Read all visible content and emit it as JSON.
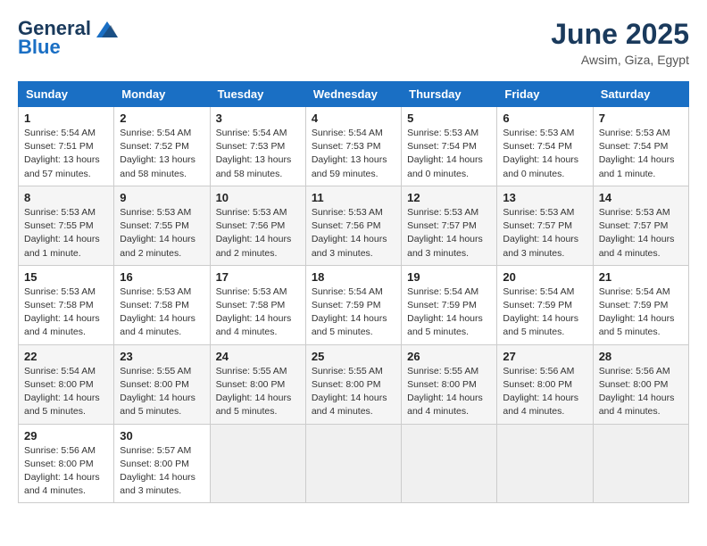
{
  "header": {
    "logo_general": "General",
    "logo_blue": "Blue",
    "month_title": "June 2025",
    "location": "Awsim, Giza, Egypt"
  },
  "weekdays": [
    "Sunday",
    "Monday",
    "Tuesday",
    "Wednesday",
    "Thursday",
    "Friday",
    "Saturday"
  ],
  "weeks": [
    [
      {
        "day": 1,
        "sunrise": "5:54 AM",
        "sunset": "7:51 PM",
        "daylight": "13 hours and 57 minutes."
      },
      {
        "day": 2,
        "sunrise": "5:54 AM",
        "sunset": "7:52 PM",
        "daylight": "13 hours and 58 minutes."
      },
      {
        "day": 3,
        "sunrise": "5:54 AM",
        "sunset": "7:53 PM",
        "daylight": "13 hours and 58 minutes."
      },
      {
        "day": 4,
        "sunrise": "5:54 AM",
        "sunset": "7:53 PM",
        "daylight": "13 hours and 59 minutes."
      },
      {
        "day": 5,
        "sunrise": "5:53 AM",
        "sunset": "7:54 PM",
        "daylight": "14 hours and 0 minutes."
      },
      {
        "day": 6,
        "sunrise": "5:53 AM",
        "sunset": "7:54 PM",
        "daylight": "14 hours and 0 minutes."
      },
      {
        "day": 7,
        "sunrise": "5:53 AM",
        "sunset": "7:54 PM",
        "daylight": "14 hours and 1 minute."
      }
    ],
    [
      {
        "day": 8,
        "sunrise": "5:53 AM",
        "sunset": "7:55 PM",
        "daylight": "14 hours and 1 minute."
      },
      {
        "day": 9,
        "sunrise": "5:53 AM",
        "sunset": "7:55 PM",
        "daylight": "14 hours and 2 minutes."
      },
      {
        "day": 10,
        "sunrise": "5:53 AM",
        "sunset": "7:56 PM",
        "daylight": "14 hours and 2 minutes."
      },
      {
        "day": 11,
        "sunrise": "5:53 AM",
        "sunset": "7:56 PM",
        "daylight": "14 hours and 3 minutes."
      },
      {
        "day": 12,
        "sunrise": "5:53 AM",
        "sunset": "7:57 PM",
        "daylight": "14 hours and 3 minutes."
      },
      {
        "day": 13,
        "sunrise": "5:53 AM",
        "sunset": "7:57 PM",
        "daylight": "14 hours and 3 minutes."
      },
      {
        "day": 14,
        "sunrise": "5:53 AM",
        "sunset": "7:57 PM",
        "daylight": "14 hours and 4 minutes."
      }
    ],
    [
      {
        "day": 15,
        "sunrise": "5:53 AM",
        "sunset": "7:58 PM",
        "daylight": "14 hours and 4 minutes."
      },
      {
        "day": 16,
        "sunrise": "5:53 AM",
        "sunset": "7:58 PM",
        "daylight": "14 hours and 4 minutes."
      },
      {
        "day": 17,
        "sunrise": "5:53 AM",
        "sunset": "7:58 PM",
        "daylight": "14 hours and 4 minutes."
      },
      {
        "day": 18,
        "sunrise": "5:54 AM",
        "sunset": "7:59 PM",
        "daylight": "14 hours and 5 minutes."
      },
      {
        "day": 19,
        "sunrise": "5:54 AM",
        "sunset": "7:59 PM",
        "daylight": "14 hours and 5 minutes."
      },
      {
        "day": 20,
        "sunrise": "5:54 AM",
        "sunset": "7:59 PM",
        "daylight": "14 hours and 5 minutes."
      },
      {
        "day": 21,
        "sunrise": "5:54 AM",
        "sunset": "7:59 PM",
        "daylight": "14 hours and 5 minutes."
      }
    ],
    [
      {
        "day": 22,
        "sunrise": "5:54 AM",
        "sunset": "8:00 PM",
        "daylight": "14 hours and 5 minutes."
      },
      {
        "day": 23,
        "sunrise": "5:55 AM",
        "sunset": "8:00 PM",
        "daylight": "14 hours and 5 minutes."
      },
      {
        "day": 24,
        "sunrise": "5:55 AM",
        "sunset": "8:00 PM",
        "daylight": "14 hours and 5 minutes."
      },
      {
        "day": 25,
        "sunrise": "5:55 AM",
        "sunset": "8:00 PM",
        "daylight": "14 hours and 4 minutes."
      },
      {
        "day": 26,
        "sunrise": "5:55 AM",
        "sunset": "8:00 PM",
        "daylight": "14 hours and 4 minutes."
      },
      {
        "day": 27,
        "sunrise": "5:56 AM",
        "sunset": "8:00 PM",
        "daylight": "14 hours and 4 minutes."
      },
      {
        "day": 28,
        "sunrise": "5:56 AM",
        "sunset": "8:00 PM",
        "daylight": "14 hours and 4 minutes."
      }
    ],
    [
      {
        "day": 29,
        "sunrise": "5:56 AM",
        "sunset": "8:00 PM",
        "daylight": "14 hours and 4 minutes."
      },
      {
        "day": 30,
        "sunrise": "5:57 AM",
        "sunset": "8:00 PM",
        "daylight": "14 hours and 3 minutes."
      },
      null,
      null,
      null,
      null,
      null
    ]
  ]
}
